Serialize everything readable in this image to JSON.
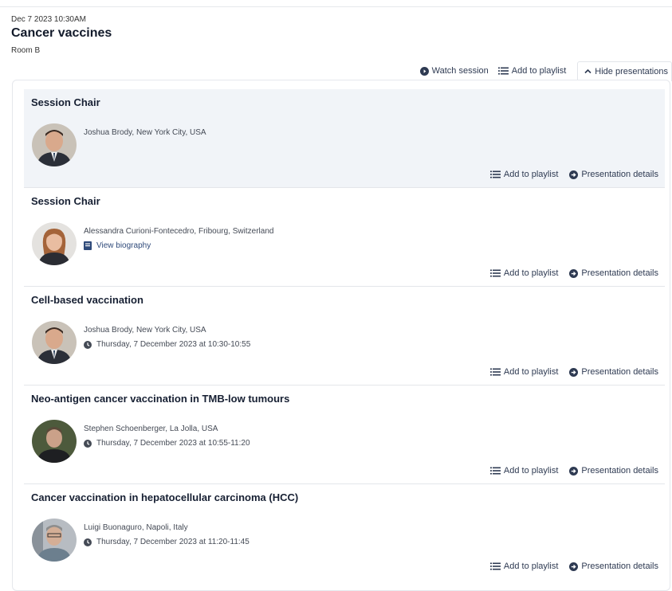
{
  "session": {
    "date": "Dec 7 2023 10:30AM",
    "title": "Cancer vaccines",
    "room": "Room B"
  },
  "toolbar": {
    "watch_label": "Watch session",
    "playlist_label": "Add to playlist",
    "hide_label": "Hide presentations"
  },
  "presentations": [
    {
      "title": "Session Chair",
      "speaker": "Joshua Brody, New York City, USA",
      "meta": "",
      "add_label": "Add to playlist",
      "details_label": "Presentation details"
    },
    {
      "title": "Session Chair",
      "speaker": "Alessandra Curioni-Fontecedro, Fribourg, Switzerland",
      "meta": "View biography",
      "add_label": "Add to playlist",
      "details_label": "Presentation details"
    },
    {
      "title": "Cell-based vaccination",
      "speaker": "Joshua Brody, New York City, USA",
      "meta": "Thursday, 7 December 2023 at 10:30-10:55",
      "add_label": "Add to playlist",
      "details_label": "Presentation details"
    },
    {
      "title": "Neo-antigen cancer vaccination in TMB-low tumours",
      "speaker": "Stephen Schoenberger, La Jolla, USA",
      "meta": "Thursday, 7 December 2023 at 10:55-11:20",
      "add_label": "Add to playlist",
      "details_label": "Presentation details"
    },
    {
      "title": "Cancer vaccination in hepatocellular carcinoma (HCC)",
      "speaker": "Luigi Buonaguro, Napoli, Italy",
      "meta": "Thursday, 7 December 2023 at 11:20-11:45",
      "add_label": "Add to playlist",
      "details_label": "Presentation details"
    }
  ],
  "icons": {
    "watch": "play-circle-icon",
    "playlist": "list-icon",
    "hide": "chevron-up-icon",
    "details": "arrow-circle-right-icon",
    "biography": "book-icon",
    "time": "clock-icon"
  },
  "colors": {
    "text_dark": "#172033",
    "action": "#2e3a52",
    "highlight_bg": "#f1f4f8",
    "border": "#e3e6ea"
  }
}
